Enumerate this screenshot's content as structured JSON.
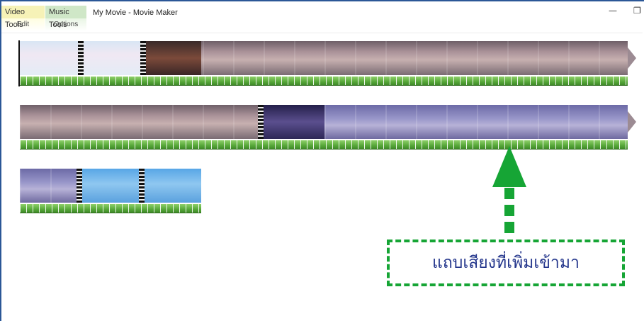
{
  "tabs": {
    "video_tools": {
      "group": "Video Tools",
      "tab": "Edit"
    },
    "music_tools": {
      "group": "Music Tools",
      "tab": "Options"
    }
  },
  "window": {
    "title": "My Movie - Movie Maker",
    "minimize": "—",
    "maximize": "❐"
  },
  "annotation": {
    "label": "แถบเสียงที่เพิ่มเข้ามา",
    "color": "#16a535",
    "text_color": "#24368c"
  },
  "icons": [
    "minimize-icon",
    "maximize-icon",
    "arrow-up-icon",
    "clip-end-arrow-icon"
  ]
}
